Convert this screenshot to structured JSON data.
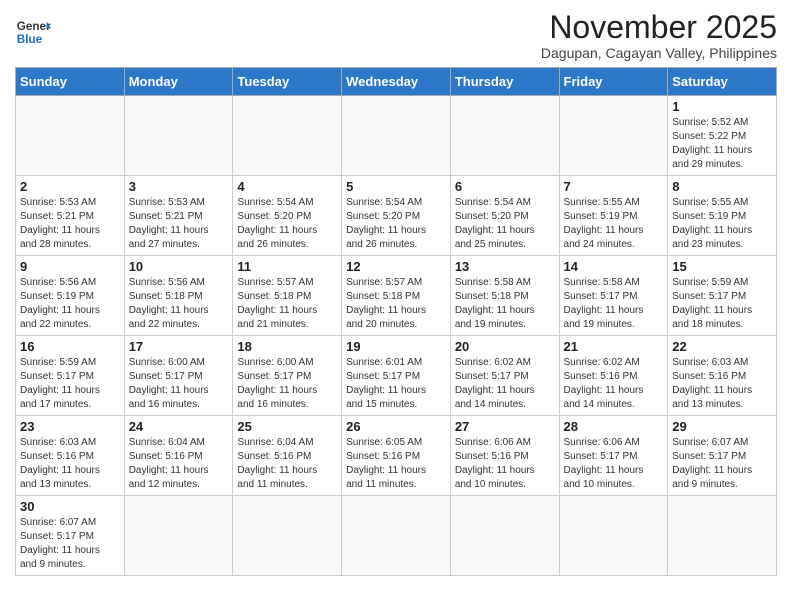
{
  "header": {
    "logo_general": "General",
    "logo_blue": "Blue",
    "month_title": "November 2025",
    "subtitle": "Dagupan, Cagayan Valley, Philippines"
  },
  "days_of_week": [
    "Sunday",
    "Monday",
    "Tuesday",
    "Wednesday",
    "Thursday",
    "Friday",
    "Saturday"
  ],
  "weeks": [
    [
      {
        "day": "",
        "info": ""
      },
      {
        "day": "",
        "info": ""
      },
      {
        "day": "",
        "info": ""
      },
      {
        "day": "",
        "info": ""
      },
      {
        "day": "",
        "info": ""
      },
      {
        "day": "",
        "info": ""
      },
      {
        "day": "1",
        "info": "Sunrise: 5:52 AM\nSunset: 5:22 PM\nDaylight: 11 hours\nand 29 minutes."
      }
    ],
    [
      {
        "day": "2",
        "info": "Sunrise: 5:53 AM\nSunset: 5:21 PM\nDaylight: 11 hours\nand 28 minutes."
      },
      {
        "day": "3",
        "info": "Sunrise: 5:53 AM\nSunset: 5:21 PM\nDaylight: 11 hours\nand 27 minutes."
      },
      {
        "day": "4",
        "info": "Sunrise: 5:54 AM\nSunset: 5:20 PM\nDaylight: 11 hours\nand 26 minutes."
      },
      {
        "day": "5",
        "info": "Sunrise: 5:54 AM\nSunset: 5:20 PM\nDaylight: 11 hours\nand 26 minutes."
      },
      {
        "day": "6",
        "info": "Sunrise: 5:54 AM\nSunset: 5:20 PM\nDaylight: 11 hours\nand 25 minutes."
      },
      {
        "day": "7",
        "info": "Sunrise: 5:55 AM\nSunset: 5:19 PM\nDaylight: 11 hours\nand 24 minutes."
      },
      {
        "day": "8",
        "info": "Sunrise: 5:55 AM\nSunset: 5:19 PM\nDaylight: 11 hours\nand 23 minutes."
      }
    ],
    [
      {
        "day": "9",
        "info": "Sunrise: 5:56 AM\nSunset: 5:19 PM\nDaylight: 11 hours\nand 22 minutes."
      },
      {
        "day": "10",
        "info": "Sunrise: 5:56 AM\nSunset: 5:18 PM\nDaylight: 11 hours\nand 22 minutes."
      },
      {
        "day": "11",
        "info": "Sunrise: 5:57 AM\nSunset: 5:18 PM\nDaylight: 11 hours\nand 21 minutes."
      },
      {
        "day": "12",
        "info": "Sunrise: 5:57 AM\nSunset: 5:18 PM\nDaylight: 11 hours\nand 20 minutes."
      },
      {
        "day": "13",
        "info": "Sunrise: 5:58 AM\nSunset: 5:18 PM\nDaylight: 11 hours\nand 19 minutes."
      },
      {
        "day": "14",
        "info": "Sunrise: 5:58 AM\nSunset: 5:17 PM\nDaylight: 11 hours\nand 19 minutes."
      },
      {
        "day": "15",
        "info": "Sunrise: 5:59 AM\nSunset: 5:17 PM\nDaylight: 11 hours\nand 18 minutes."
      }
    ],
    [
      {
        "day": "16",
        "info": "Sunrise: 5:59 AM\nSunset: 5:17 PM\nDaylight: 11 hours\nand 17 minutes."
      },
      {
        "day": "17",
        "info": "Sunrise: 6:00 AM\nSunset: 5:17 PM\nDaylight: 11 hours\nand 16 minutes."
      },
      {
        "day": "18",
        "info": "Sunrise: 6:00 AM\nSunset: 5:17 PM\nDaylight: 11 hours\nand 16 minutes."
      },
      {
        "day": "19",
        "info": "Sunrise: 6:01 AM\nSunset: 5:17 PM\nDaylight: 11 hours\nand 15 minutes."
      },
      {
        "day": "20",
        "info": "Sunrise: 6:02 AM\nSunset: 5:17 PM\nDaylight: 11 hours\nand 14 minutes."
      },
      {
        "day": "21",
        "info": "Sunrise: 6:02 AM\nSunset: 5:16 PM\nDaylight: 11 hours\nand 14 minutes."
      },
      {
        "day": "22",
        "info": "Sunrise: 6:03 AM\nSunset: 5:16 PM\nDaylight: 11 hours\nand 13 minutes."
      }
    ],
    [
      {
        "day": "23",
        "info": "Sunrise: 6:03 AM\nSunset: 5:16 PM\nDaylight: 11 hours\nand 13 minutes."
      },
      {
        "day": "24",
        "info": "Sunrise: 6:04 AM\nSunset: 5:16 PM\nDaylight: 11 hours\nand 12 minutes."
      },
      {
        "day": "25",
        "info": "Sunrise: 6:04 AM\nSunset: 5:16 PM\nDaylight: 11 hours\nand 11 minutes."
      },
      {
        "day": "26",
        "info": "Sunrise: 6:05 AM\nSunset: 5:16 PM\nDaylight: 11 hours\nand 11 minutes."
      },
      {
        "day": "27",
        "info": "Sunrise: 6:06 AM\nSunset: 5:16 PM\nDaylight: 11 hours\nand 10 minutes."
      },
      {
        "day": "28",
        "info": "Sunrise: 6:06 AM\nSunset: 5:17 PM\nDaylight: 11 hours\nand 10 minutes."
      },
      {
        "day": "29",
        "info": "Sunrise: 6:07 AM\nSunset: 5:17 PM\nDaylight: 11 hours\nand 9 minutes."
      }
    ],
    [
      {
        "day": "30",
        "info": "Sunrise: 6:07 AM\nSunset: 5:17 PM\nDaylight: 11 hours\nand 9 minutes."
      },
      {
        "day": "",
        "info": ""
      },
      {
        "day": "",
        "info": ""
      },
      {
        "day": "",
        "info": ""
      },
      {
        "day": "",
        "info": ""
      },
      {
        "day": "",
        "info": ""
      },
      {
        "day": "",
        "info": ""
      }
    ]
  ]
}
